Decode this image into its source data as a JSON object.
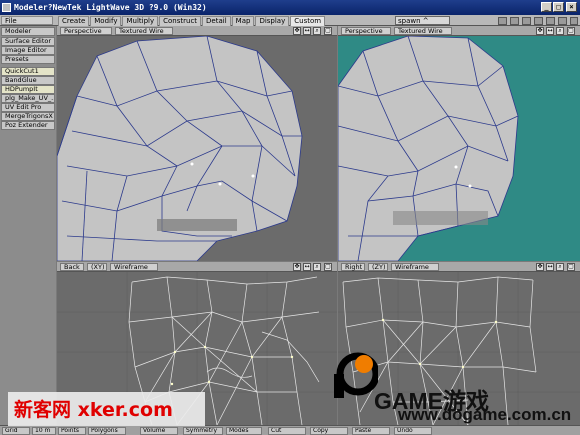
{
  "window": {
    "title": "Modeler?NewTek LightWave 3D ?9.0 (Win32)",
    "buttons": [
      "_",
      "□",
      "×"
    ]
  },
  "toolbar": {
    "file_menu": "File",
    "tabs": [
      "Create",
      "Modify",
      "Multiply",
      "Construct",
      "Detail",
      "Map",
      "Display",
      "Custom"
    ],
    "active_tab": "Custom",
    "spawn": "spawn ^"
  },
  "sidebar": {
    "items": [
      "Modeler",
      "Surface Editor",
      "Image Editor",
      "Presets",
      "QuickCut1",
      "BandGlue",
      "HDPumpIt",
      "plg_Make_UV_...",
      "UV Edit Pro",
      "MergeTrigonsX",
      "Poz Extender"
    ]
  },
  "viewports": {
    "top_left": {
      "view": "Perspective",
      "mode": "Textured Wire"
    },
    "top_right": {
      "view": "Perspective",
      "mode": "Textured Wire"
    },
    "bottom_left": {
      "view": "Back",
      "axes": "(XY)",
      "mode": "Wireframe"
    },
    "bottom_right": {
      "view": "Right",
      "axes": "(ZY)",
      "mode": "Wireframe"
    },
    "controls": [
      "✥",
      "↔",
      "⌕",
      "▢"
    ],
    "colors": {
      "bg_gray": "#6b6b6b",
      "bg_teal": "#2f8a85",
      "mesh": "#c4c4c4",
      "wire": "#2c3a8c"
    }
  },
  "bottombar": {
    "items": [
      "Grid",
      "10 m",
      "Points",
      "Polygons",
      "Volume",
      "Symmetry",
      "Modes",
      "Cut",
      "Copy",
      "Paste",
      "Undo"
    ]
  },
  "watermarks": {
    "xker": "新客网 xker.com",
    "game_line1": "GAME游戏",
    "game_line2": "www.dogame.com.cn"
  }
}
